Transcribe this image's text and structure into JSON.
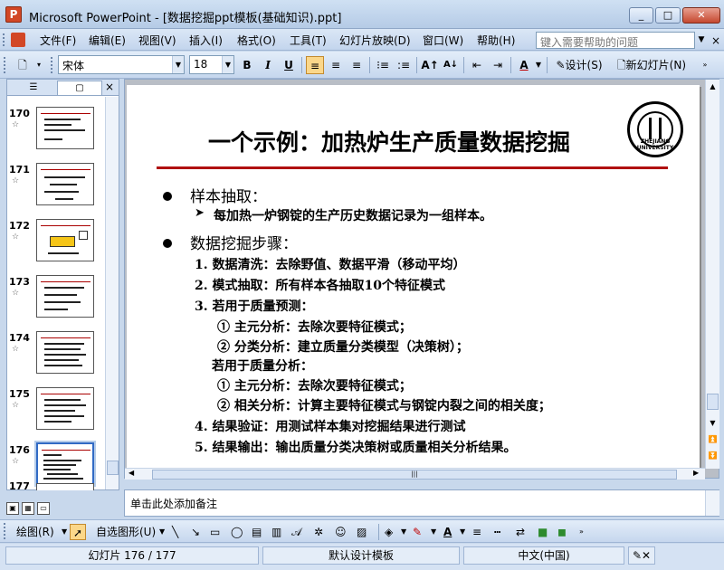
{
  "window": {
    "title": "Microsoft PowerPoint - [数据挖掘ppt模板(基础知识).ppt]",
    "min_label": "_",
    "max_label": "□",
    "close_label": "✕"
  },
  "menu": {
    "items": [
      "文件(F)",
      "编辑(E)",
      "视图(V)",
      "插入(I)",
      "格式(O)",
      "工具(T)",
      "幻灯片放映(D)",
      "窗口(W)",
      "帮助(H)"
    ],
    "help_placeholder": "键入需要帮助的问题",
    "close": "×"
  },
  "toolbar": {
    "font": "宋体",
    "size": "18",
    "bold": "B",
    "italic": "I",
    "underline": "U",
    "design_label": "设计(S)",
    "new_slide_label": "新幻灯片(N)",
    "font_color_label": "A"
  },
  "thumbnails": {
    "tab_close": "×",
    "items": [
      {
        "num": "170",
        "star": "☆"
      },
      {
        "num": "171",
        "star": "☆"
      },
      {
        "num": "172",
        "star": "☆"
      },
      {
        "num": "173",
        "star": "☆"
      },
      {
        "num": "174",
        "star": "☆"
      },
      {
        "num": "175",
        "star": "☆"
      },
      {
        "num": "176",
        "star": "☆"
      },
      {
        "num": "177",
        "star": ""
      }
    ],
    "selected": "176"
  },
  "slide": {
    "title": "一个示例：加热炉生产质量数据挖掘",
    "logo_text": "ZHEJIANG UNIVERSITY",
    "logo_year": "1897",
    "bullets": [
      "样本抽取：",
      "数据挖掘步骤："
    ],
    "sub_item": "每加热一炉钢锭的生产历史数据记录为一组样本。",
    "steps": [
      "1.  数据清洗：去除野值、数据平滑（移动平均）",
      "2.  模式抽取：所有样本各抽取10个特征模式",
      "3.  若用于质量预测：",
      "①  主元分析：去除次要特征模式；",
      "②  分类分析：建立质量分类模型（决策树）；",
      "若用于质量分析：",
      "①  主元分析：去除次要特征模式；",
      "②  相关分析：计算主要特征模式与钢锭内裂之间的相关度；",
      "4.  结果验证：用测试样本集对挖掘结果进行测试",
      "5.  结果输出：输出质量分类决策树或质量相关分析结果。"
    ]
  },
  "notes": {
    "placeholder": "单击此处添加备注"
  },
  "drawbar": {
    "draw_label": "绘图(R)",
    "autoshapes_label": "自选图形(U)"
  },
  "status": {
    "slide_info": "幻灯片 176 / 177",
    "template": "默认设计模板",
    "language": "中文(中国)"
  }
}
